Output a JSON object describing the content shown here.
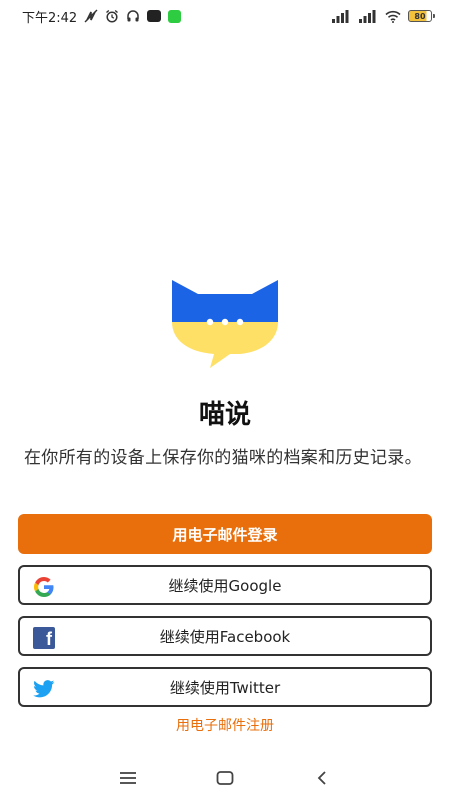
{
  "status_bar": {
    "time": "下午2:42",
    "battery": "80"
  },
  "app": {
    "name": "喵说",
    "tagline": "在你所有的设备上保存你的猫咪的档案和历史记录。"
  },
  "login": {
    "email_label": "用电子邮件登录",
    "google_label": "继续使用Google",
    "facebook_label": "继续使用Facebook",
    "twitter_label": "继续使用Twitter",
    "register_label": "用电子邮件注册"
  },
  "colors": {
    "accent": "#e86f0c",
    "logo_blue": "#1c64e6",
    "logo_yellow": "#ffe066",
    "facebook": "#3b5998",
    "twitter": "#1da1f2"
  },
  "icons": {
    "google": "google-icon",
    "facebook": "facebook-icon",
    "twitter": "twitter-icon"
  }
}
